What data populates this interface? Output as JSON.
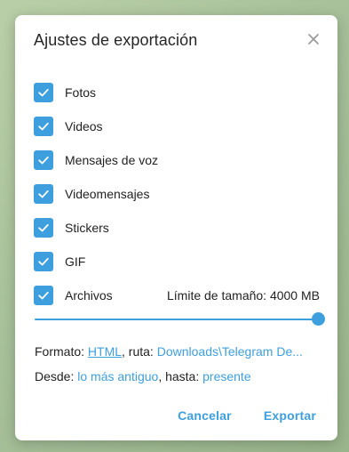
{
  "dialog": {
    "title": "Ajustes de exportación",
    "close_icon": "close-icon"
  },
  "options": [
    {
      "label": "Fotos",
      "checked": true
    },
    {
      "label": "Videos",
      "checked": true
    },
    {
      "label": "Mensajes de voz",
      "checked": true
    },
    {
      "label": "Videomensajes",
      "checked": true
    },
    {
      "label": "Stickers",
      "checked": true
    },
    {
      "label": "GIF",
      "checked": true
    },
    {
      "label": "Archivos",
      "checked": true
    }
  ],
  "size_limit": {
    "label": "Límite de tamaño: 4000 MB",
    "fraction": 1.0
  },
  "format_line": {
    "prefix": "Formato: ",
    "format_link": "HTML",
    "middle": ", ruta: ",
    "path_link": "Downloads\\Telegram De..."
  },
  "range_line": {
    "prefix": "Desde: ",
    "from_link": "lo más antiguo",
    "middle": ", hasta: ",
    "to_link": "presente"
  },
  "buttons": {
    "cancel": "Cancelar",
    "export": "Exportar"
  },
  "colors": {
    "accent": "#3e9fde",
    "text": "#222222"
  }
}
